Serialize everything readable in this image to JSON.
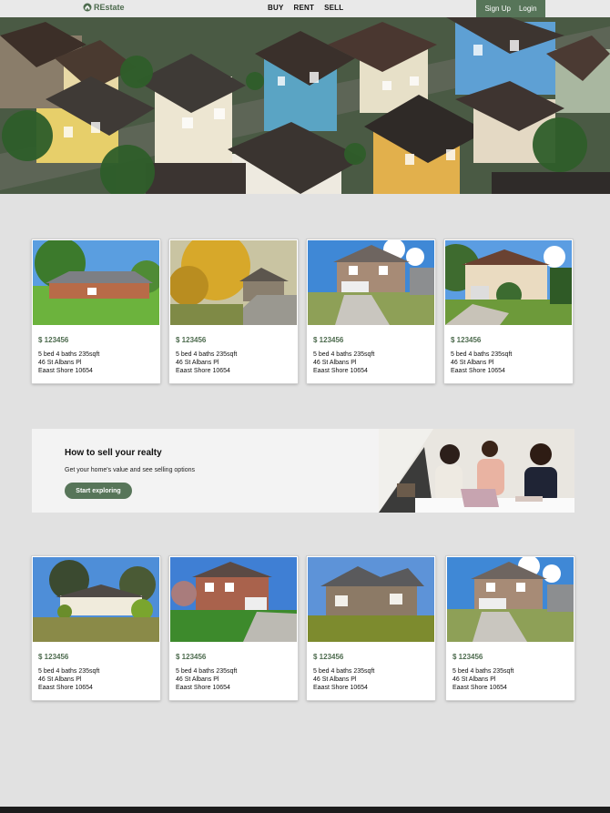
{
  "header": {
    "brand": "REstate",
    "nav": [
      "BUY",
      "RENT",
      "SELL"
    ],
    "signup_label": "Sign Up",
    "login_label": "Login"
  },
  "listings_top": [
    {
      "price": "$ 123456",
      "details": "5 bed 4 baths 235sqft",
      "street": "46 St Albans Pl",
      "area": "Eaast Shore 10654"
    },
    {
      "price": "$ 123456",
      "details": "5 bed 4 baths 235sqft",
      "street": "46 St Albans Pl",
      "area": "Eaast Shore 10654"
    },
    {
      "price": "$ 123456",
      "details": "5 bed 4 baths 235sqft",
      "street": "46 St Albans Pl",
      "area": "Eaast Shore 10654"
    },
    {
      "price": "$ 123456",
      "details": "5 bed 4 baths 235sqft",
      "street": "46 St Albans Pl",
      "area": "Eaast Shore 10654"
    }
  ],
  "sell_banner": {
    "title": "How to sell your realty",
    "subtitle": "Get your home's value and see selling options",
    "button_label": "Start exploring"
  },
  "listings_bottom": [
    {
      "price": "$ 123456",
      "details": "5 bed 4 baths 235sqft",
      "street": "46 St Albans Pl",
      "area": "Eaast Shore 10654"
    },
    {
      "price": "$ 123456",
      "details": "5 bed 4 baths 235sqft",
      "street": "46 St Albans Pl",
      "area": "Eaast Shore 10654"
    },
    {
      "price": "$ 123456",
      "details": "5 bed 4 baths 235sqft",
      "street": "46 St Albans Pl",
      "area": "Eaast Shore 10654"
    },
    {
      "price": "$ 123456",
      "details": "5 bed 4 baths 235sqft",
      "street": "46 St Albans Pl",
      "area": "Eaast Shore 10654"
    }
  ],
  "colors": {
    "brand": "#577559",
    "price": "#4d6b4e",
    "background": "#e1e1e1"
  },
  "icons": [
    "home-icon"
  ]
}
